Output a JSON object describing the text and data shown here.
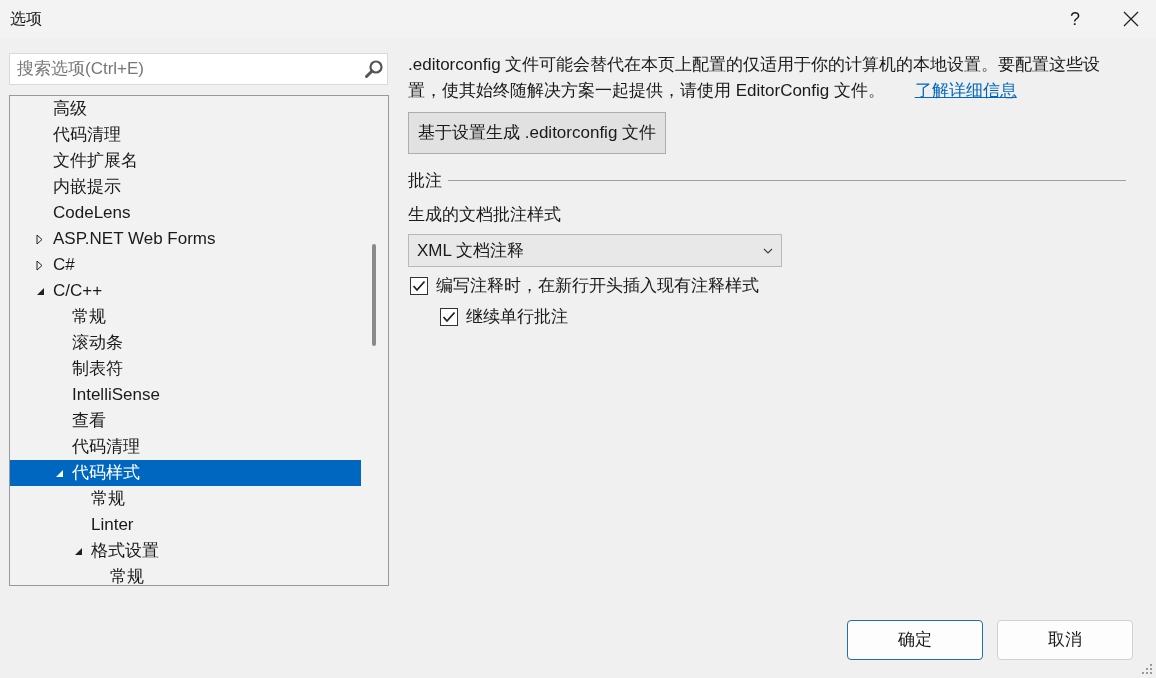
{
  "window": {
    "title": "选项",
    "help": "?"
  },
  "search": {
    "placeholder": "搜索选项(Ctrl+E)"
  },
  "tree": [
    {
      "label": "高级",
      "kind": "leaf",
      "selected": false
    },
    {
      "label": "代码清理",
      "kind": "leaf",
      "selected": false
    },
    {
      "label": "文件扩展名",
      "kind": "leaf",
      "selected": false
    },
    {
      "label": "内嵌提示",
      "kind": "leaf",
      "selected": false
    },
    {
      "label": "CodeLens",
      "kind": "leaf",
      "selected": false
    },
    {
      "label": "ASP.NET Web Forms",
      "kind": "group",
      "expanded": false,
      "selected": false
    },
    {
      "label": "C#",
      "kind": "group",
      "expanded": false,
      "selected": false
    },
    {
      "label": "C/C++",
      "kind": "group",
      "expanded": true,
      "selected": false,
      "children": [
        {
          "label": "常规",
          "kind": "leaf",
          "selected": false
        },
        {
          "label": "滚动条",
          "kind": "leaf",
          "selected": false
        },
        {
          "label": "制表符",
          "kind": "leaf",
          "selected": false
        },
        {
          "label": "IntelliSense",
          "kind": "leaf",
          "selected": false
        },
        {
          "label": "查看",
          "kind": "leaf",
          "selected": false
        },
        {
          "label": "代码清理",
          "kind": "leaf",
          "selected": false
        },
        {
          "label": "代码样式",
          "kind": "group",
          "expanded": true,
          "selected": true,
          "children": [
            {
              "label": "常规",
              "kind": "leaf",
              "selected": false
            },
            {
              "label": "Linter",
              "kind": "leaf",
              "selected": false
            },
            {
              "label": "格式设置",
              "kind": "group",
              "expanded": true,
              "selected": false,
              "children": [
                {
                  "label": "常规",
                  "kind": "leaf",
                  "selected": false
                }
              ]
            }
          ]
        }
      ]
    }
  ],
  "info": {
    "text": ".editorconfig 文件可能会替代在本页上配置的仅适用于你的计算机的本地设置。要配置这些设置，使其始终随解决方案一起提供，请使用 EditorConfig 文件。",
    "link": "了解详细信息"
  },
  "generate_button": "基于设置生成 .editorconfig 文件",
  "section": {
    "title": "批注",
    "dropdown_label": "生成的文档批注样式",
    "dropdown_value": "XML 文档注释",
    "options": [
      {
        "label": "编写注释时，在新行开头插入现有注释样式",
        "checked": true,
        "kind": "main"
      },
      {
        "label": "继续单行批注",
        "checked": true,
        "kind": "sub"
      }
    ]
  },
  "buttons": [
    {
      "label": "确定",
      "default": true
    },
    {
      "label": "取消",
      "default": false
    }
  ]
}
